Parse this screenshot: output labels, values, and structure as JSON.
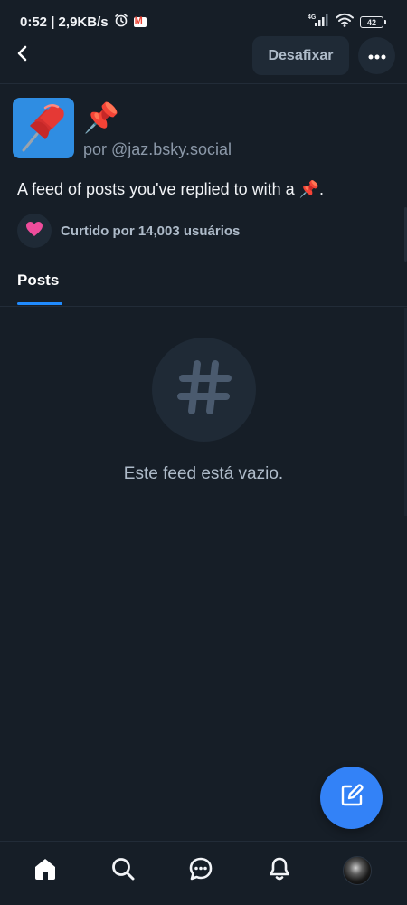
{
  "status_bar": {
    "time_speed": "0:52 | 2,9KB/s",
    "network": "4G",
    "battery": "42",
    "icons": [
      "alarm-icon",
      "gmail-icon",
      "signal-icon",
      "wifi-icon",
      "battery-icon"
    ]
  },
  "header": {
    "back_icon": "chevron-left-icon",
    "unpin_label": "Desafixar",
    "more_icon": "more-horizontal-icon"
  },
  "feed": {
    "avatar_icon": "pushpin-icon",
    "title": "📌",
    "author": "por @jaz.bsky.social",
    "description": "A feed of posts you've replied to with a 📌.",
    "like_text": "Curtido por 14,003 usuários",
    "like_color": "#ee4c9b"
  },
  "tabs": [
    {
      "label": "Posts",
      "active": true
    }
  ],
  "empty_state": {
    "icon": "hashtag-icon",
    "text": "Este feed está vazio."
  },
  "fab": {
    "icon": "compose-icon",
    "color": "#3382f7"
  },
  "bottom_nav": {
    "items": [
      {
        "name": "home",
        "icon": "home-icon",
        "active": true
      },
      {
        "name": "search",
        "icon": "search-icon",
        "active": false
      },
      {
        "name": "chat",
        "icon": "chat-icon",
        "active": false
      },
      {
        "name": "notifications",
        "icon": "bell-icon",
        "active": false
      },
      {
        "name": "profile",
        "icon": "avatar",
        "active": false
      }
    ]
  },
  "colors": {
    "background": "#161e27",
    "surface": "#1f2a36",
    "accent": "#208bfe",
    "text_primary": "#f2f4f7",
    "text_secondary": "#aebbc9"
  }
}
